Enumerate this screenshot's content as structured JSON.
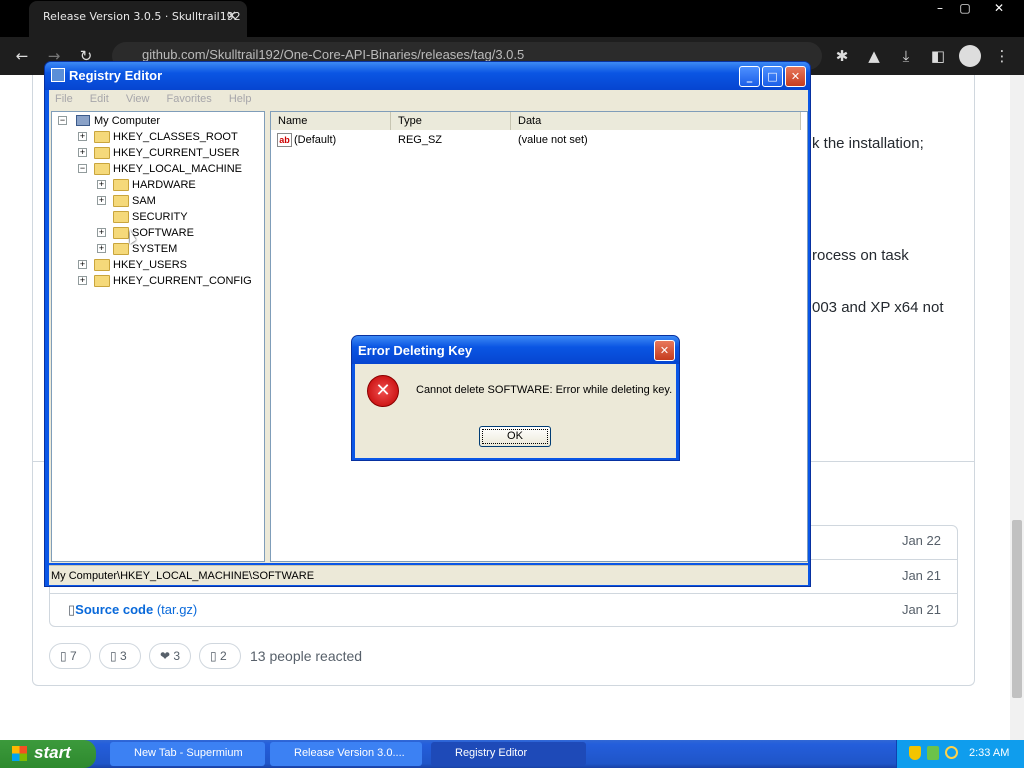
{
  "browser": {
    "tab_title": "Release Version 3.0.5 · Skulltrail192",
    "url": "github.com/Skulltrail192/One-Core-API-Binaries/releases/tag/3.0.5",
    "win_min": "–",
    "win_max": "▢",
    "win_close": "✕",
    "tab_close": "✕"
  },
  "page": {
    "frag1": "k the installation;",
    "frag2": "rocess on task",
    "frag3": "003 and XP x64 not",
    "assets": [
      {
        "date": "Jan 22"
      },
      {
        "date": "Jan 21"
      },
      {
        "label": "Source code",
        "sub": "(tar.gz)",
        "date": "Jan 21"
      }
    ],
    "reactions": [
      {
        "icon": "thumbs-up",
        "count": "7"
      },
      {
        "icon": "laugh",
        "count": "3"
      },
      {
        "icon": "heart",
        "symbol": "❤",
        "count": "3"
      },
      {
        "icon": "rocket",
        "count": "2"
      }
    ],
    "reacted_text": "13 people reacted"
  },
  "regedit": {
    "title": "Registry Editor",
    "menu": [
      "File",
      "Edit",
      "View",
      "Favorites",
      "Help"
    ],
    "tree": {
      "root": "My Computer",
      "items": [
        {
          "label": "HKEY_CLASSES_ROOT",
          "level": 1,
          "expander": "+"
        },
        {
          "label": "HKEY_CURRENT_USER",
          "level": 1,
          "expander": "+"
        },
        {
          "label": "HKEY_LOCAL_MACHINE",
          "level": 1,
          "expander": "−"
        },
        {
          "label": "HARDWARE",
          "level": 2,
          "expander": "+"
        },
        {
          "label": "SAM",
          "level": 2,
          "expander": "+"
        },
        {
          "label": "SECURITY",
          "level": 2,
          "expander": ""
        },
        {
          "label": "SOFTWARE",
          "level": 2,
          "expander": "+"
        },
        {
          "label": "SYSTEM",
          "level": 2,
          "expander": "+"
        },
        {
          "label": "HKEY_USERS",
          "level": 1,
          "expander": "+"
        },
        {
          "label": "HKEY_CURRENT_CONFIG",
          "level": 1,
          "expander": "+"
        }
      ]
    },
    "columns": [
      "Name",
      "Type",
      "Data"
    ],
    "values": [
      {
        "icon": "ab",
        "name": "(Default)",
        "type": "REG_SZ",
        "data": "(value not set)"
      }
    ],
    "status": "My Computer\\HKEY_LOCAL_MACHINE\\SOFTWARE"
  },
  "dialog": {
    "title": "Error Deleting Key",
    "message": "Cannot delete SOFTWARE:  Error while deleting key.",
    "ok": "OK",
    "icon_glyph": "✕"
  },
  "taskbar": {
    "start": "start",
    "items": [
      {
        "label": "New Tab - Supermium",
        "active": false
      },
      {
        "label": "Release Version 3.0....",
        "active": false
      },
      {
        "label": "Registry Editor",
        "active": true
      }
    ],
    "clock": "2:33 AM"
  }
}
